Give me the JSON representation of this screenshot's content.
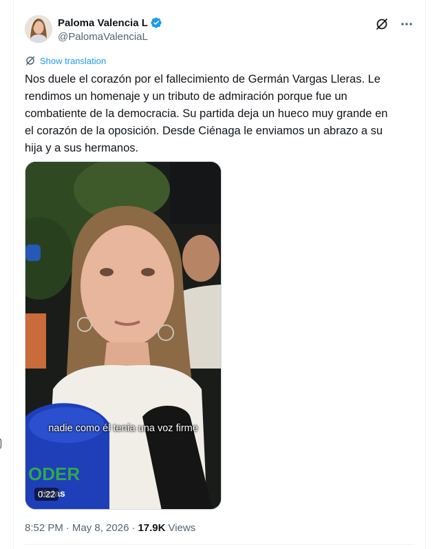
{
  "author": {
    "display_name": "Paloma Valencia L",
    "handle": "@PalomaValenciaL",
    "verified": true,
    "verified_color": "#1d9bf0"
  },
  "actions": {
    "grok_icon": "grok-icon",
    "more_icon": "more-icon"
  },
  "translation": {
    "label": "Show translation",
    "icon": "translate-icon"
  },
  "tweet": {
    "text": "Nos duele el corazón por el fallecimiento de Germán Vargas Lleras. Le\nrendimos un homenaje y un tributo de admiración porque fue un\ncombatiente de la democracia. Su partida deja un hueco muy grande en\nel corazón de la oposición. Desde Ciénaga le enviamos un abrazo a su\nhija y a sus hermanos."
  },
  "video": {
    "subtitle": "nadie como él tenía una voz firme",
    "duration": "0:22",
    "mic_text_left": "ODER",
    "mic_text_left_2": "ticias"
  },
  "meta": {
    "time": "8:52 PM",
    "separator": "·",
    "date": "May 8, 2026",
    "views_count": "17.9K",
    "views_label": "Views"
  },
  "colors": {
    "accent": "#1d9bf0",
    "text_primary": "#0f1419",
    "text_secondary": "#536471"
  }
}
